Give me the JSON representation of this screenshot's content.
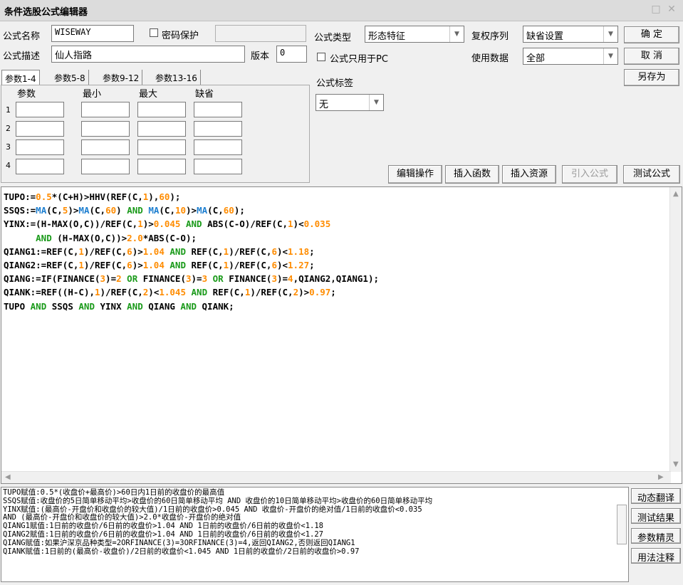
{
  "window": {
    "title": "条件选股公式编辑器"
  },
  "form": {
    "name_label": "公式名称",
    "name_value": "WISEWAY",
    "password_label": "密码保护",
    "desc_label": "公式描述",
    "desc_value": "仙人指路",
    "version_label": "版本",
    "version_value": "0",
    "type_label": "公式类型",
    "type_value": "形态特征",
    "pc_only_label": "公式只用于PC",
    "fq_label": "复权序列",
    "fq_value": "缺省设置",
    "data_label": "使用数据",
    "data_value": "全部",
    "tag_label": "公式标签",
    "tag_value": "无"
  },
  "buttons": {
    "ok": "确  定",
    "cancel": "取  消",
    "save_as": "另存为",
    "edit_ops": "编辑操作",
    "insert_func": "插入函数",
    "insert_res": "插入资源",
    "import_formula": "引入公式",
    "test_formula": "测试公式",
    "dyn_translate": "动态翻译",
    "test_result": "测试结果",
    "param_wizard": "参数精灵",
    "usage_note": "用法注释"
  },
  "param_tabs": [
    "参数1-4",
    "参数5-8",
    "参数9-12",
    "参数13-16"
  ],
  "param_headers": [
    "参数",
    "最小",
    "最大",
    "缺省"
  ],
  "param_rows": [
    "1",
    "2",
    "3",
    "4"
  ],
  "code_lines": [
    "TUPO:=0.5*(C+H)>HHV(REF(C,1),60);",
    "SSQS:=MA(C,5)>MA(C,60) AND MA(C,10)>MA(C,60);",
    "YINX:=(H-MAX(O,C))/REF(C,1)>0.045 AND ABS(C-O)/REF(C,1)<0.035",
    "      AND (H-MAX(O,C))>2.0*ABS(C-O);",
    "QIANG1:=REF(C,1)/REF(C,6)>1.04 AND REF(C,1)/REF(C,6)<1.18;",
    "QIANG2:=REF(C,1)/REF(C,6)>1.04 AND REF(C,1)/REF(C,6)<1.27;",
    "QIANG:=IF(FINANCE(3)=2 OR FINANCE(3)=3 OR FINANCE(3)=4,QIANG2,QIANG1);",
    "QIANK:=REF((H-C),1)/REF(C,2)<1.045 AND REF(C,1)/REF(C,2)>0.97;",
    "TUPO AND SSQS AND YINX AND QIANG AND QIANK;"
  ],
  "explain_lines": [
    "TUPO赋值:0.5*(收盘价+最高价)>60日内1日前的收盘价的最高值",
    "SSQS赋值:收盘价的5日简单移动平均>收盘价的60日简单移动平均 AND 收盘价的10日简单移动平均>收盘价的60日简单移动平均",
    "YINX赋值:(最高价-开盘价和收盘价的较大值)/1日前的收盘价>0.045 AND 收盘价-开盘价的绝对值/1日前的收盘价<0.035",
    "AND (最高价-开盘价和收盘价的较大值)>2.0*收盘价-开盘价的绝对值",
    "QIANG1赋值:1日前的收盘价/6日前的收盘价>1.04 AND 1日前的收盘价/6日前的收盘价<1.18",
    "QIANG2赋值:1日前的收盘价/6日前的收盘价>1.04 AND 1日前的收盘价/6日前的收盘价<1.27",
    "QIANG赋值:如果沪深京品种类型=2ORFINANCE(3)=3ORFINANCE(3)=4,返回QIANG2,否则返回QIANG1",
    "QIANK赋值:1日前的(最高价-收盘价)/2日前的收盘价<1.045 AND 1日前的收盘价/2日前的收盘价>0.97"
  ]
}
